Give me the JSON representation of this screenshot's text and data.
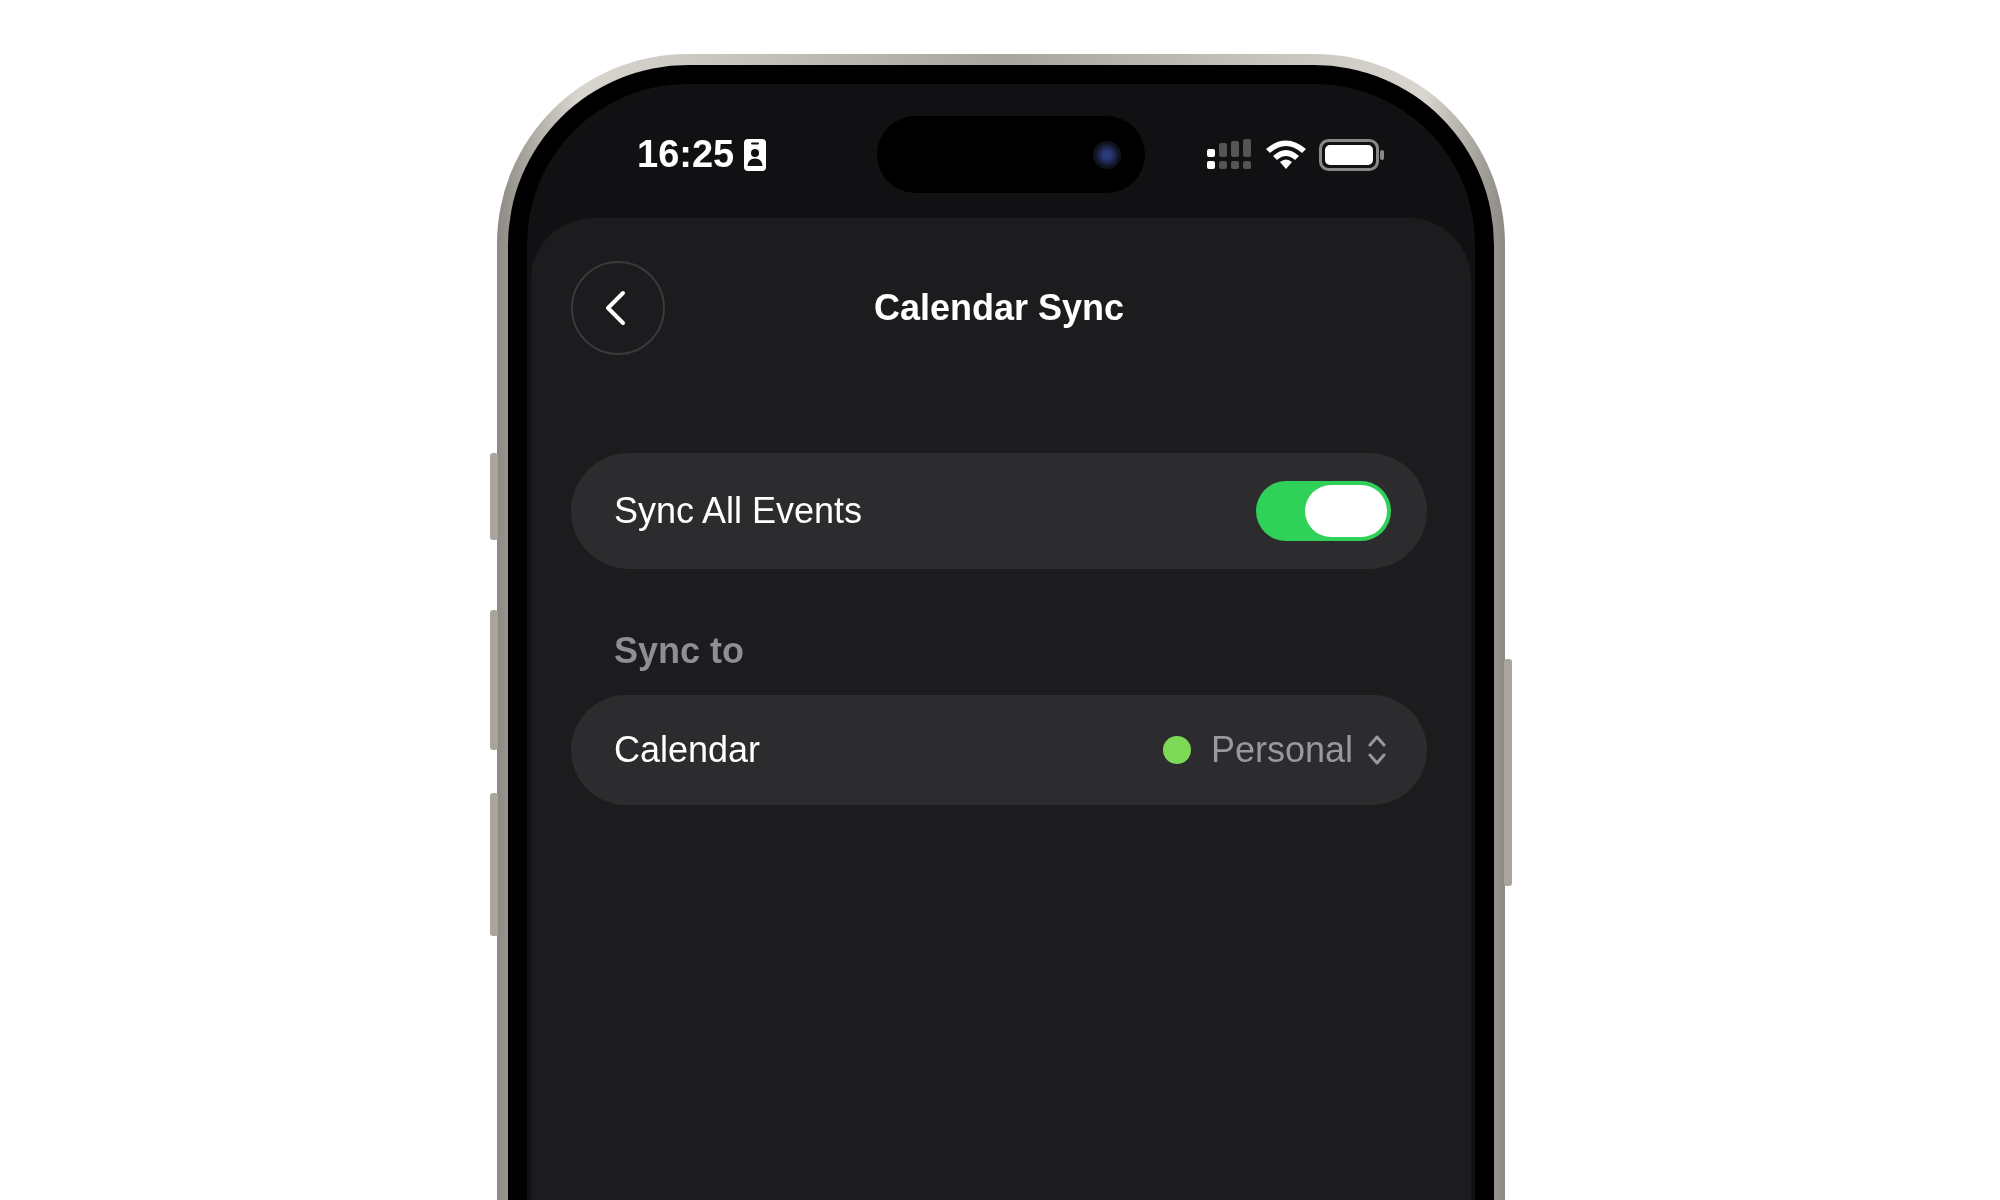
{
  "status_bar": {
    "time": "16:25"
  },
  "header": {
    "title": "Calendar Sync"
  },
  "rows": [
    {
      "kind": "toggle",
      "label": "Sync All Events",
      "on": true
    },
    {
      "kind": "section",
      "label": "Sync to"
    },
    {
      "kind": "picker",
      "label": "Calendar",
      "value": "Personal",
      "color": "#7ed957"
    }
  ]
}
